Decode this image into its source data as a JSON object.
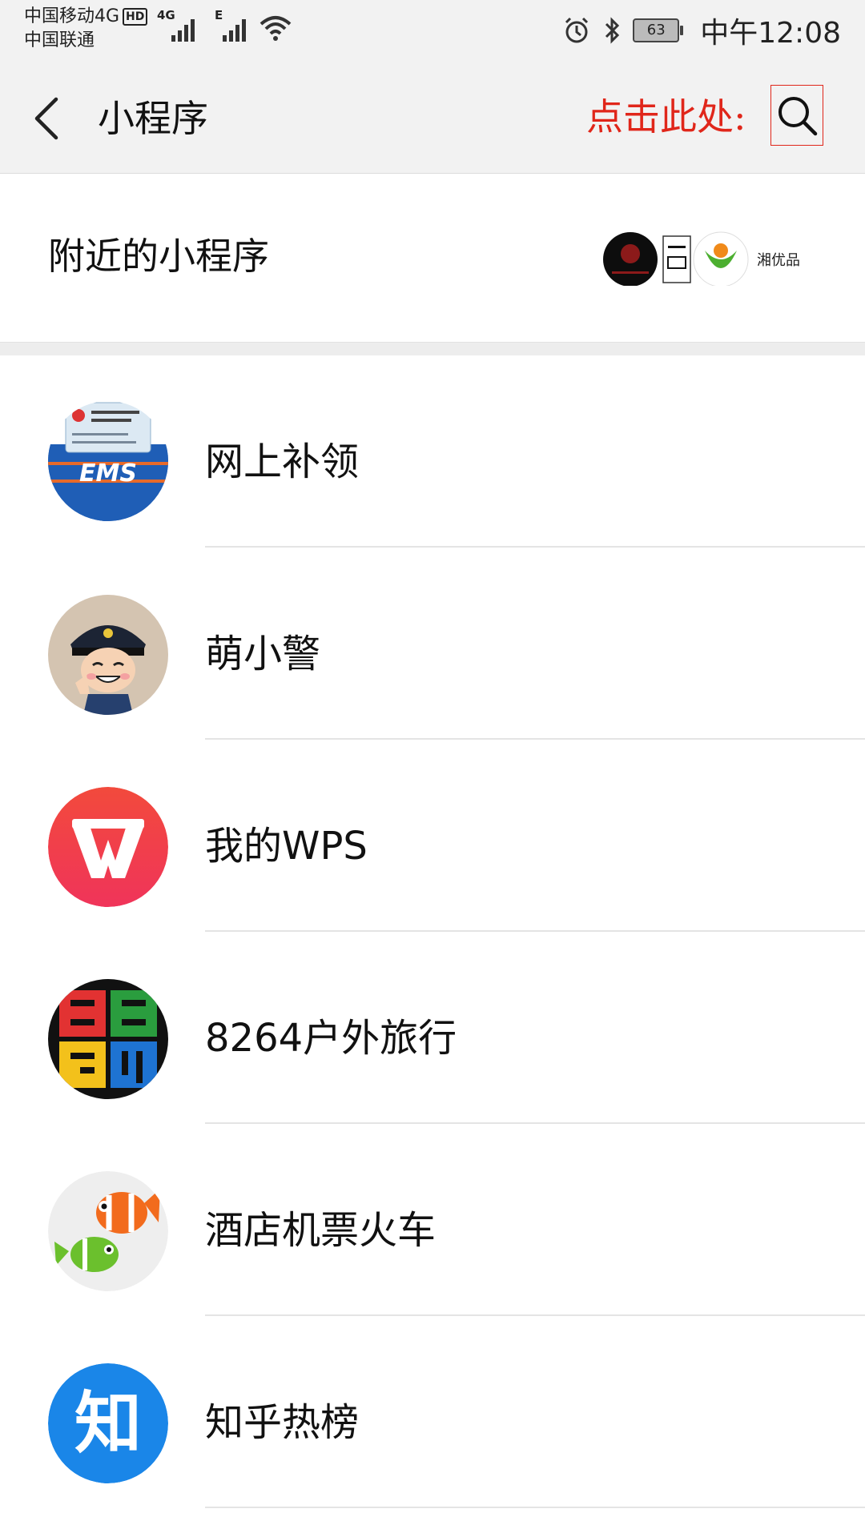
{
  "status_bar": {
    "carrier_1": "中国移动4G",
    "carrier_hd": "HD",
    "carrier_2": "中国联通",
    "signal_1_label": "4G",
    "signal_2_label": "E",
    "battery": "63",
    "time": "中午12:08"
  },
  "navbar": {
    "title": "小程序",
    "hint": "点击此处:"
  },
  "nearby": {
    "label": "附近的小程序",
    "icon_4_text": "湘优品"
  },
  "list": [
    {
      "label": "网上补领",
      "icon": "ems-id-card-icon"
    },
    {
      "label": "萌小警",
      "icon": "police-cartoon-icon"
    },
    {
      "label": "我的WPS",
      "icon": "wps-icon"
    },
    {
      "label": "8264户外旅行",
      "icon": "8264-icon"
    },
    {
      "label": "酒店机票火车",
      "icon": "clownfish-icon"
    },
    {
      "label": "知乎热榜",
      "icon": "zhihu-icon"
    }
  ],
  "icon_text": {
    "ems": "EMS",
    "zhihu": "知"
  },
  "colors": {
    "hint_red": "#e0261a",
    "wps_red": "#f03a4a",
    "zhihu_blue": "#1a86e8",
    "ems_blue": "#1f5eb6"
  }
}
